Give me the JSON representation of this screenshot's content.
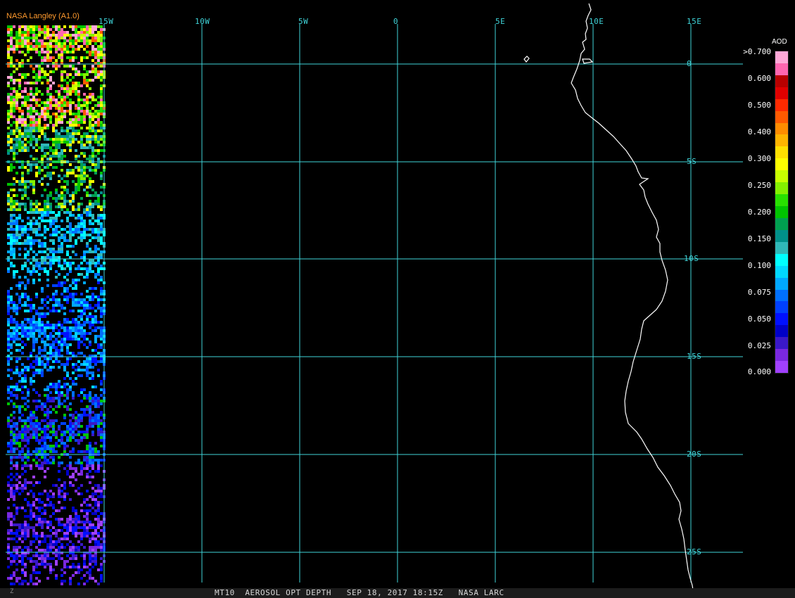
{
  "credit": "NASA Langley (A1.0)",
  "lon_labels": [
    "15W",
    "10W",
    "5W",
    "0",
    "5E",
    "10E",
    "15E"
  ],
  "lat_labels": [
    "0",
    "5S",
    "10S",
    "15S",
    "20S",
    "25S"
  ],
  "legend": {
    "title": "AOD",
    "labels": [
      ">0.700",
      "0.600",
      "0.500",
      "0.400",
      "0.300",
      "0.250",
      "0.200",
      "0.150",
      "0.100",
      "0.075",
      "0.050",
      "0.025",
      "0.000"
    ],
    "colors": [
      "#ffa8d8",
      "#ff66b0",
      "#b80000",
      "#e00000",
      "#ff2a00",
      "#ff5a00",
      "#ff8c00",
      "#ffb400",
      "#ffe000",
      "#ffff00",
      "#c8ff00",
      "#84f000",
      "#28e000",
      "#00c400",
      "#00a050",
      "#00908a",
      "#30b8b8",
      "#00ffff",
      "#00d8ff",
      "#00a8ff",
      "#0070ff",
      "#0040ff",
      "#0010ff",
      "#0000c8",
      "#3a18c8",
      "#7a28e0",
      "#a040ff"
    ]
  },
  "status": "MT10  AEROSOL OPT DEPTH   SEP 18, 2017 18:15Z   NASA LARC",
  "corner_mark": "Z",
  "colors": {
    "grid": "#3fd3d8",
    "coast": "#ffffff",
    "credit": "#ff9a2e"
  }
}
